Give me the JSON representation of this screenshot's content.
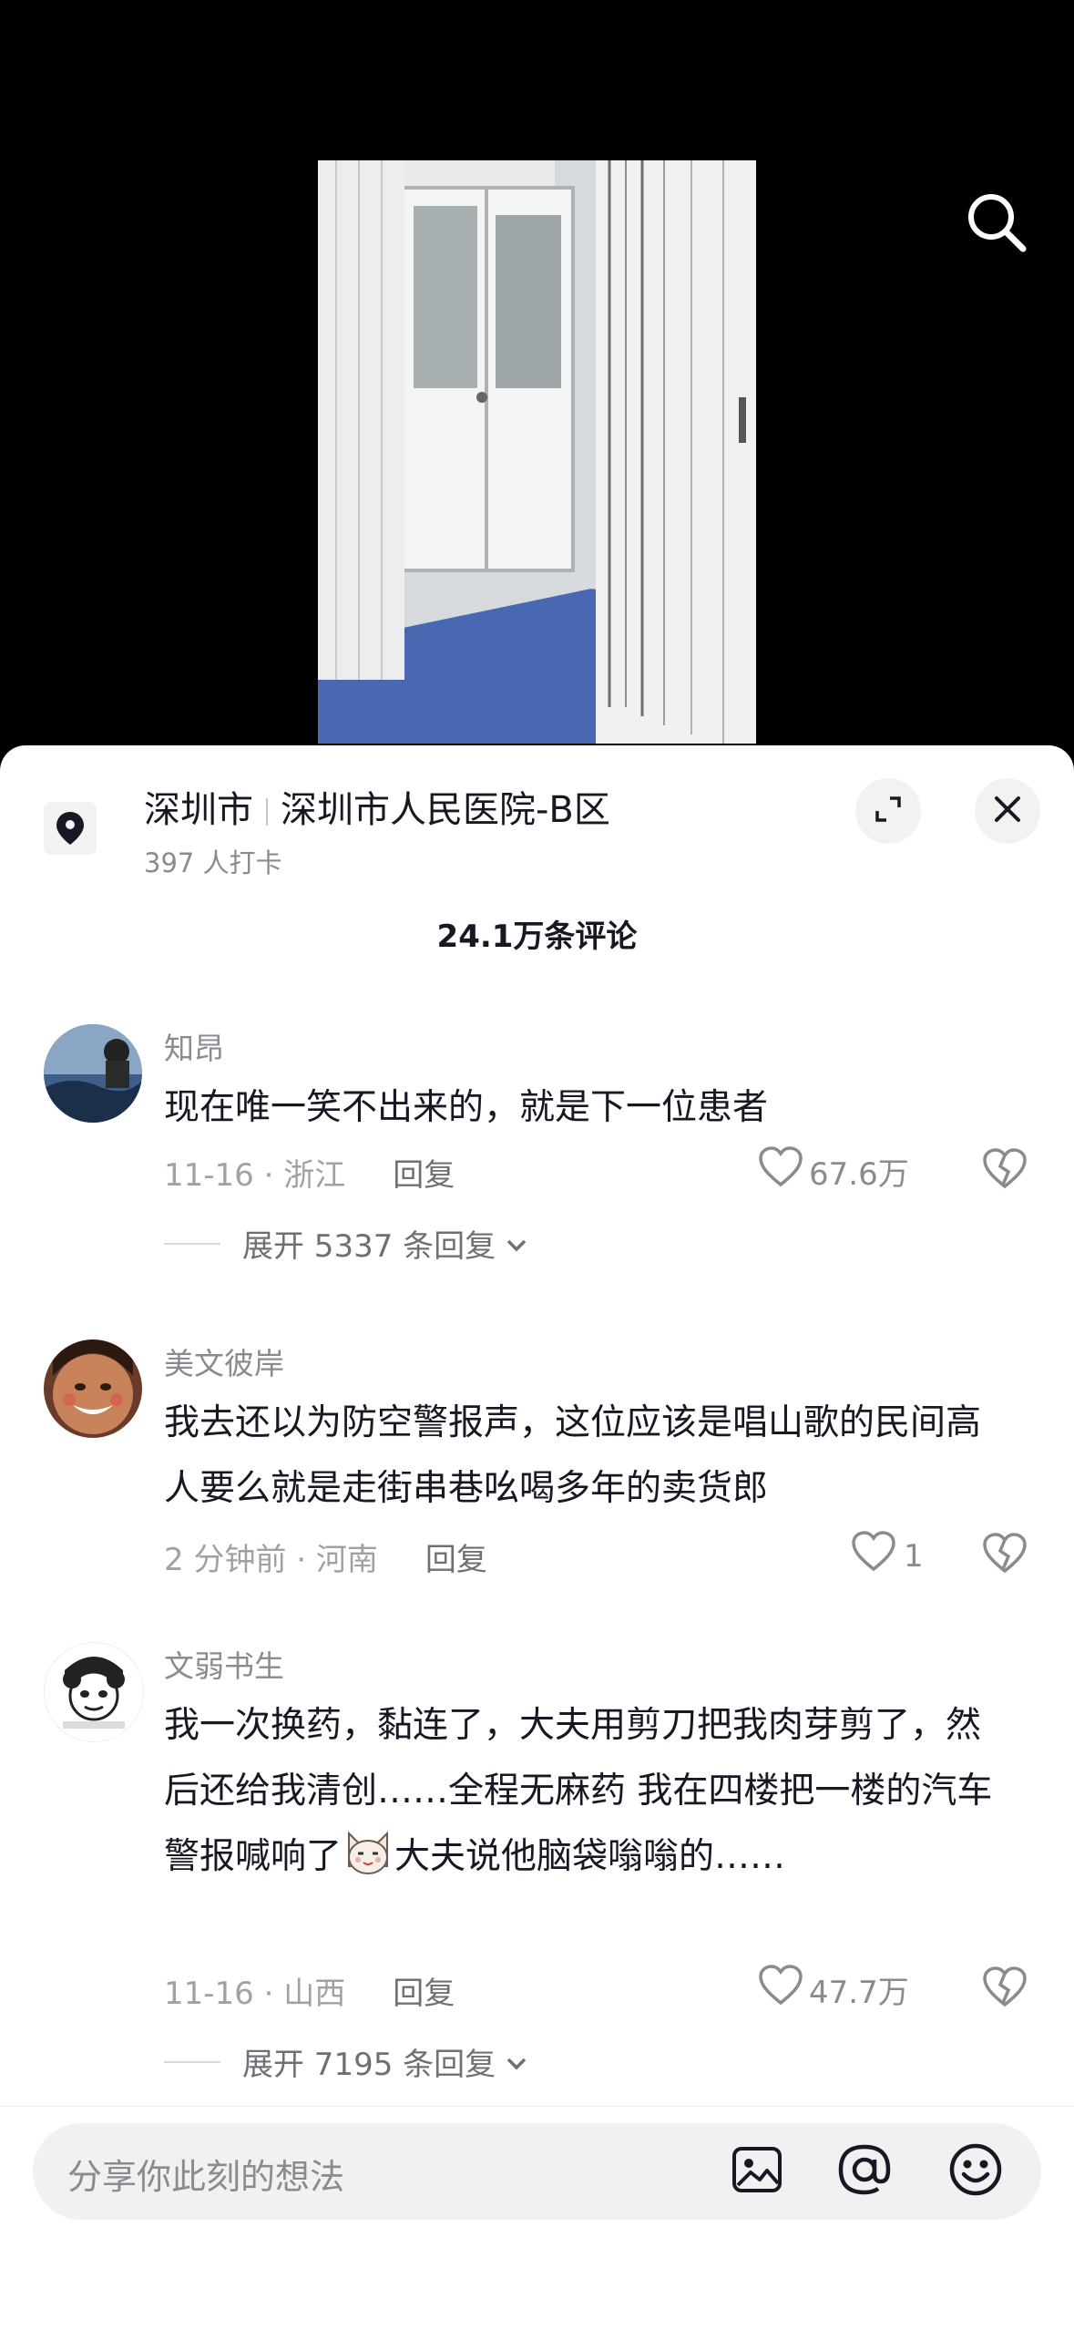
{
  "location": {
    "city": "深圳市",
    "place": "深圳市人民医院-B区",
    "checkins": "397 人打卡"
  },
  "comments_header": {
    "count_label": "24.1万条评论"
  },
  "comments": [
    {
      "user": "知昂",
      "text": "现在唯一笑不出来的，就是下一位患者",
      "time": "11-16",
      "region": "浙江",
      "reply_label": "回复",
      "likes": "67.6万",
      "expand_label": "展开 5337 条回复"
    },
    {
      "user": "美文彼岸",
      "text": "我去还以为防空警报声，这位应该是唱山歌的民间高人要么就是走街串巷吆喝多年的卖货郎",
      "time": "2 分钟前",
      "region": "河南",
      "reply_label": "回复",
      "likes": "1"
    },
    {
      "user": "文弱书生",
      "text_before": "我一次换药，黏连了，大夫用剪刀把我肉芽剪了，然后还给我清创……全程无麻药 我在四楼把一楼的汽车警报喊响了",
      "text_after": "大夫说他脑袋嗡嗡的……",
      "emoji": "cat-face-emoji",
      "time": "11-16",
      "region": "山西",
      "reply_label": "回复",
      "likes": "47.7万",
      "expand_label": "展开 7195 条回复"
    }
  ],
  "input": {
    "placeholder": "分享你此刻的想法"
  },
  "icons": {
    "search": "search-icon",
    "location": "location-pin-icon",
    "expand": "expand-icon",
    "close": "close-icon",
    "like": "heart-icon",
    "dislike": "broken-heart-icon",
    "image": "image-icon",
    "mention": "at-icon",
    "emoji": "emoji-icon"
  }
}
